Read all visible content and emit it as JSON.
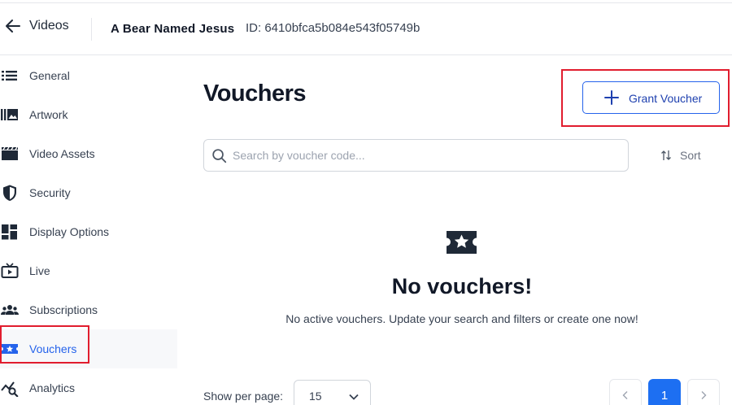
{
  "header": {
    "back_label": "Videos",
    "video_title": "A Bear Named Jesus",
    "video_id": "ID: 6410bfca5b084e543f05749b"
  },
  "sidebar": {
    "items": [
      {
        "label": "General",
        "icon": "list-icon",
        "active": false
      },
      {
        "label": "Artwork",
        "icon": "artwork-icon",
        "active": false
      },
      {
        "label": "Video Assets",
        "icon": "clapperboard-icon",
        "active": false
      },
      {
        "label": "Security",
        "icon": "shield-icon",
        "active": false
      },
      {
        "label": "Display Options",
        "icon": "dashboard-icon",
        "active": false
      },
      {
        "label": "Live",
        "icon": "live-tv-icon",
        "active": false
      },
      {
        "label": "Subscriptions",
        "icon": "people-icon",
        "active": false
      },
      {
        "label": "Vouchers",
        "icon": "voucher-icon",
        "active": true
      },
      {
        "label": "Analytics",
        "icon": "analytics-icon",
        "active": false
      }
    ]
  },
  "main": {
    "title": "Vouchers",
    "grant_button_label": "Grant Voucher",
    "search": {
      "placeholder": "Search by voucher code...",
      "value": ""
    },
    "sort_label": "Sort",
    "empty_state": {
      "title": "No vouchers!",
      "subtitle": "No active vouchers. Update your search and filters or create one now!"
    },
    "pagination": {
      "per_page_label": "Show per page:",
      "per_page_value": "15",
      "current_page": "1"
    }
  },
  "colors": {
    "accent": "#2563eb",
    "highlight_box": "#e11d2e",
    "active_bg": "#f7f8fa"
  }
}
